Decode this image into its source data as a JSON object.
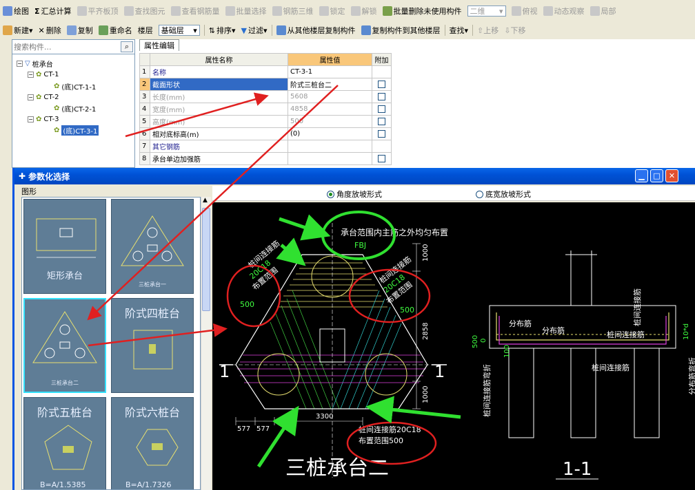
{
  "toolbar1": {
    "draw": "绘图",
    "calc": "汇总计算",
    "flat": "平齐板顶",
    "find": "查找图元",
    "view_rebar": "查看钢筋量",
    "batch_select": "批量选择",
    "rebar3d": "钢筋三维",
    "lock": "锁定",
    "unlock": "解锁",
    "batch_delete": "批量删除未使用构件",
    "mode": "二维",
    "view": "俯视",
    "dynamic": "动态观察",
    "local": "局部"
  },
  "toolbar2": {
    "new": "新建",
    "delete": "删除",
    "copy": "复制",
    "rename": "重命名",
    "floor_label": "楼层",
    "floor_value": "基础层",
    "sort": "排序",
    "filter": "过滤",
    "copy_from": "从其他楼层复制构件",
    "copy_to": "复制构件到其他楼层",
    "search": "查找",
    "up": "上移",
    "down": "下移"
  },
  "tree": {
    "search_placeholder": "搜索构件...",
    "root": "桩承台",
    "nodes": [
      "CT-1",
      "(底)CT-1-1",
      "CT-2",
      "(底)CT-2-1",
      "CT-3",
      "(底)CT-3-1"
    ]
  },
  "props": {
    "tab": "属性编辑",
    "headers": [
      "属性名称",
      "属性值",
      "附加"
    ],
    "rows": [
      {
        "n": "1",
        "name": "名称",
        "value": "CT-3-1"
      },
      {
        "n": "2",
        "name": "截面形状",
        "value": "阶式三桩台二"
      },
      {
        "n": "3",
        "name": "长度(mm)",
        "value": "5608"
      },
      {
        "n": "4",
        "name": "宽度(mm)",
        "value": "4858"
      },
      {
        "n": "5",
        "name": "高度(mm)",
        "value": "500"
      },
      {
        "n": "6",
        "name": "相对底标高(m)",
        "value": "(0)"
      },
      {
        "n": "7",
        "name": "其它钢筋",
        "value": ""
      },
      {
        "n": "8",
        "name": "承台单边加强筋",
        "value": ""
      }
    ]
  },
  "dialog": {
    "title": "参数化选择",
    "group": "图形",
    "radio1": "角度放坡形式",
    "radio2": "底宽放坡形式",
    "thumbs": [
      "矩形承台",
      "三桩承台一",
      "三桩承台二",
      "阶式四桩台",
      "阶式五桩台",
      "阶式六桩台",
      "B=A/1.5385",
      "B=A/1.7326"
    ]
  },
  "drawing": {
    "note_top": "承台范围内主筋之外均匀布置",
    "fbj": "FBJ",
    "left_text": [
      "桩间连接筋",
      "20C18",
      "布置范围",
      "500"
    ],
    "right_text": [
      "桩间连接筋",
      "20C18",
      "布置范围",
      "500"
    ],
    "bottom_text": [
      "桩间连接筋20C18",
      "布置范围500"
    ],
    "dim_v": [
      "1000",
      "2858",
      "1000"
    ],
    "dim_b": [
      "577",
      "577",
      "3300"
    ],
    "sec_mark": "1",
    "title": "三桩承台二",
    "section_title": "1-1",
    "sec_labels": [
      "分布筋",
      "分布筋",
      "桩间连接筋",
      "桩间连接筋",
      "桩间连接筋弯折",
      "分布筋弯折",
      "桩间连接筋",
      "500",
      "0",
      "100",
      "10*d"
    ]
  }
}
